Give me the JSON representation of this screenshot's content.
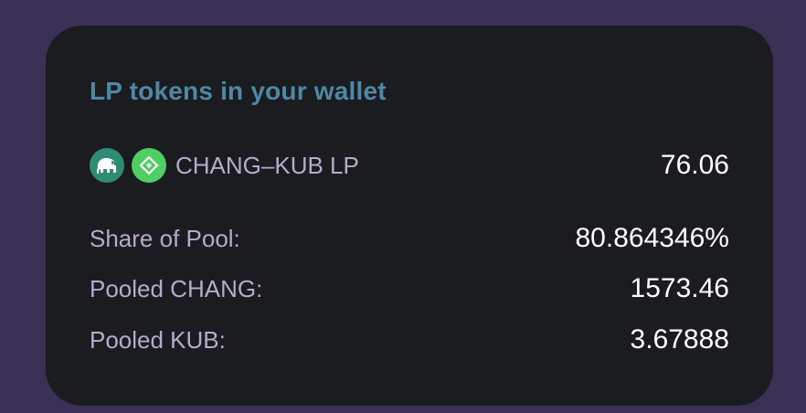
{
  "card": {
    "title": "LP tokens in your wallet",
    "pair": {
      "name": "CHANG–KUB LP",
      "balance": "76.06",
      "icons": [
        "elephant-icon",
        "kub-token-icon"
      ]
    },
    "rows": [
      {
        "label": "Share of Pool:",
        "value": "80.864346%"
      },
      {
        "label": "Pooled CHANG:",
        "value": "1573.46"
      },
      {
        "label": "Pooled KUB:",
        "value": "3.67888"
      }
    ]
  },
  "colors": {
    "page_background": "#3b3156",
    "card_background": "#1b1c20",
    "title": "#4e88a4",
    "label": "#b8aacb",
    "value": "#ffffff",
    "chang_token": "#2f8c74",
    "kub_token": "#4fcf63"
  }
}
